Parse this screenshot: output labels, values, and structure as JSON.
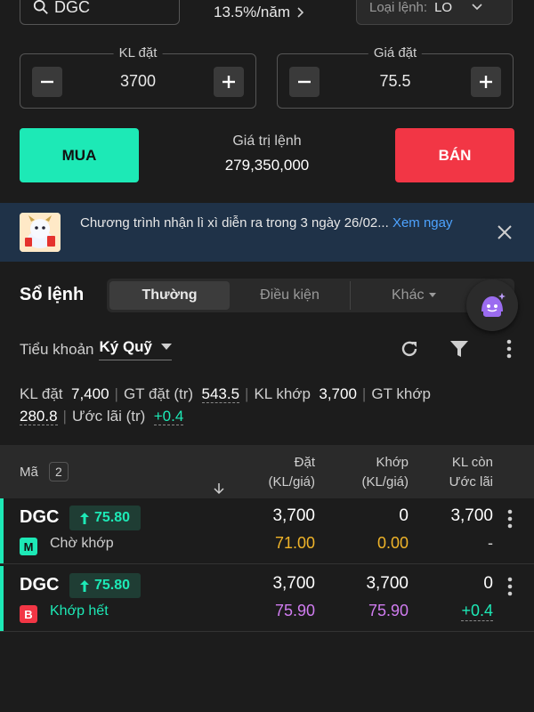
{
  "top": {
    "search_text": "DGC",
    "interest_rate": "13.5%/năm",
    "order_type_label": "Loại lệnh:",
    "order_type_value": "LO"
  },
  "order_form": {
    "qty_label": "KL đặt",
    "qty_value": "3700",
    "price_label": "Giá đặt",
    "price_value": "75.5",
    "buy_label": "MUA",
    "sell_label": "BÁN",
    "value_label": "Giá trị lệnh",
    "value_amount": "279,350,000"
  },
  "banner": {
    "text": "Chương trình nhận lì xì diễn ra trong 3 ngày 26/02...",
    "link_text": "Xem ngay"
  },
  "order_book": {
    "title": "Sổ lệnh",
    "tabs": [
      "Thường",
      "Điều kiện",
      "Khác"
    ],
    "sub_account_label": "Tiểu khoản",
    "sub_account_value": "Ký Quỹ",
    "summary": {
      "kl_dat_label": "KL đặt",
      "kl_dat_value": "7,400",
      "gt_dat_label": "GT đặt (tr)",
      "gt_dat_value": "543.5",
      "kl_khop_label": "KL khớp",
      "kl_khop_value": "3,700",
      "gt_khop_label": "GT khớp",
      "gt_khop_value": "280.8",
      "uoc_lai_label": "Ước lãi (tr)",
      "uoc_lai_value": "+0.4"
    },
    "columns": {
      "symbol": "Mã",
      "count": "2",
      "ordered_1": "Đặt",
      "ordered_2": "(KL/giá)",
      "matched_1": "Khớp",
      "matched_2": "(KL/giá)",
      "remain_1": "KL còn",
      "remain_2": "Ước lãi"
    },
    "rows": [
      {
        "symbol": "DGC",
        "price": "75.80",
        "side": "M",
        "status": "Chờ khớp",
        "ordered_qty": "3,700",
        "ordered_price": "71.00",
        "matched_qty": "0",
        "matched_price": "0.00",
        "remain_qty": "3,700",
        "est_profit": "-"
      },
      {
        "symbol": "DGC",
        "price": "75.80",
        "side": "B",
        "status": "Khớp hết",
        "ordered_qty": "3,700",
        "ordered_price": "75.90",
        "matched_qty": "3,700",
        "matched_price": "75.90",
        "remain_qty": "0",
        "est_profit": "+0.4"
      }
    ]
  },
  "colors": {
    "buy": "#1de9b6",
    "sell": "#f23645",
    "link": "#4da3ff",
    "orange_price": "#f0b429",
    "purple_price": "#d07cf0"
  }
}
